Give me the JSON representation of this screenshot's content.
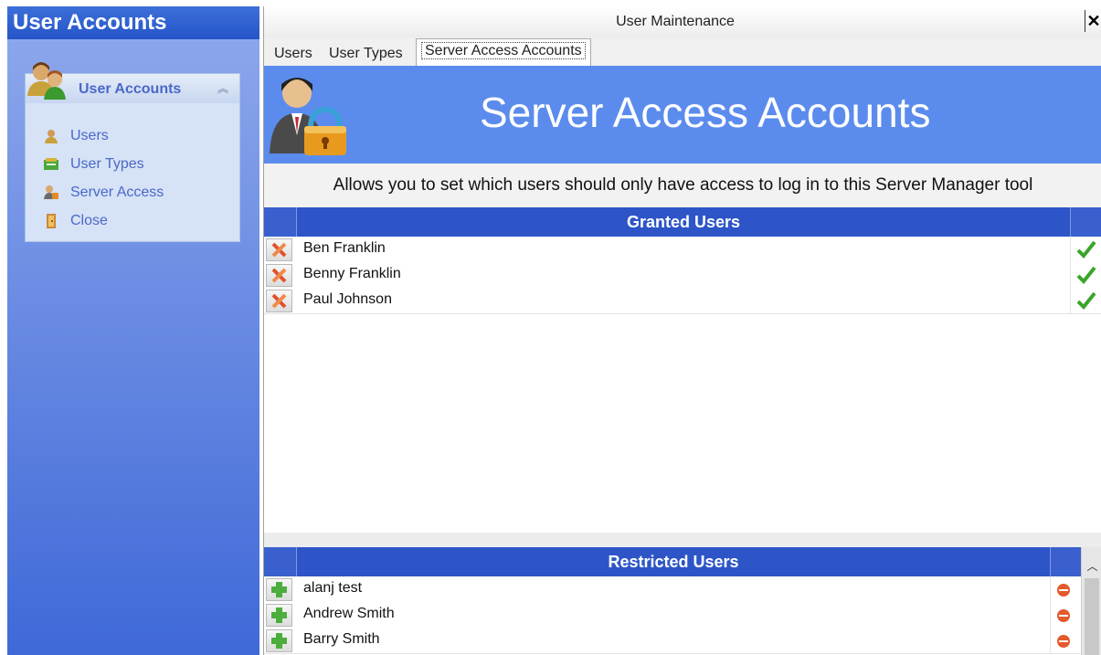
{
  "sidebar": {
    "title": "User Accounts",
    "group_label": "User Accounts",
    "items": [
      {
        "label": "Users",
        "icon": "user-icon"
      },
      {
        "label": "User Types",
        "icon": "user-types-icon"
      },
      {
        "label": "Server Access",
        "icon": "server-access-icon"
      },
      {
        "label": "Close",
        "icon": "close-door-icon"
      }
    ]
  },
  "window": {
    "title": "User Maintenance",
    "close_label": "✕"
  },
  "tabs": [
    {
      "label": "Users"
    },
    {
      "label": "User Types"
    },
    {
      "label": "Server Access Accounts",
      "active": true
    }
  ],
  "banner": {
    "title": "Server Access Accounts",
    "icon": "user-lock-icon"
  },
  "description": "Allows you to set which users should only have access to log in to this Server Manager tool",
  "granted": {
    "header": "Granted Users",
    "rows": [
      {
        "name": "Ben Franklin"
      },
      {
        "name": "Benny Franklin"
      },
      {
        "name": "Paul Johnson"
      }
    ]
  },
  "restricted": {
    "header": "Restricted Users",
    "rows": [
      {
        "name": "alanj test"
      },
      {
        "name": "Andrew Smith"
      },
      {
        "name": "Barry Smith"
      }
    ]
  },
  "colors": {
    "sidebar_gradient_top": "#8fa9ec",
    "sidebar_gradient_bottom": "#3f69d8",
    "banner_blue": "#5b8ced",
    "grid_header_blue": "#2d55c7",
    "check_green": "#3aa52a",
    "restricted_red": "#e35a2c"
  }
}
